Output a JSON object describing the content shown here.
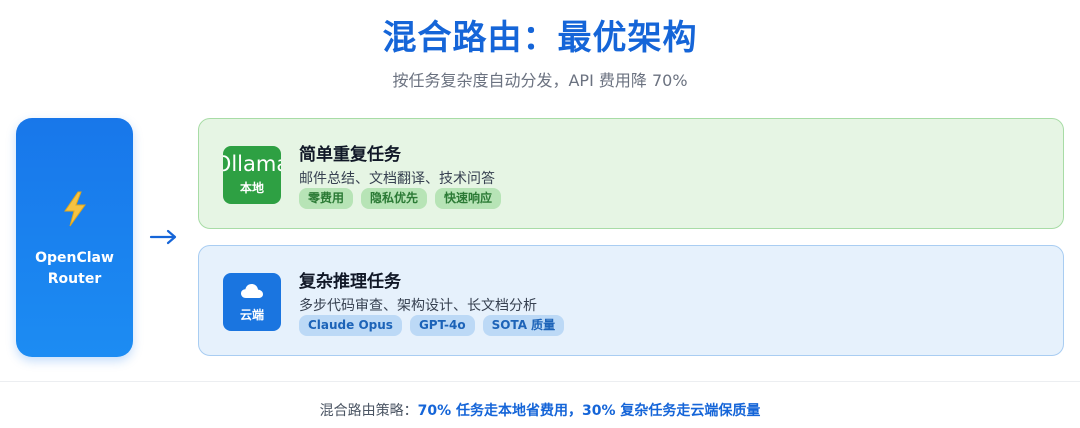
{
  "header": {
    "title": "混合路由：最优架构",
    "subtitle": "按任务复杂度自动分发，API 费用降 70%"
  },
  "router": {
    "icon": "lightning-bolt-icon",
    "name_line1": "OpenClaw",
    "name_line2": "Router",
    "color": "#1877ea"
  },
  "connector": {
    "icon": "right-arrow-icon"
  },
  "local": {
    "badge_brand": "Ollama",
    "badge_label": "本地",
    "title": "简单重复任务",
    "description": "邮件总结、文档翻译、技术问答",
    "tags": [
      "零费用",
      "隐私优先",
      "快速响应"
    ],
    "color": "#2ea043"
  },
  "cloud": {
    "badge_icon": "cloud-icon",
    "badge_label": "云端",
    "title": "复杂推理任务",
    "description": "多步代码审查、架构设计、长文档分析",
    "tags": [
      "Claude Opus",
      "GPT-4o",
      "SOTA 质量"
    ],
    "color": "#1a75e0"
  },
  "footer": {
    "prefix": "混合路由策略：",
    "highlight": "70% 任务走本地省费用，30% 复杂任务走云端保质量"
  }
}
